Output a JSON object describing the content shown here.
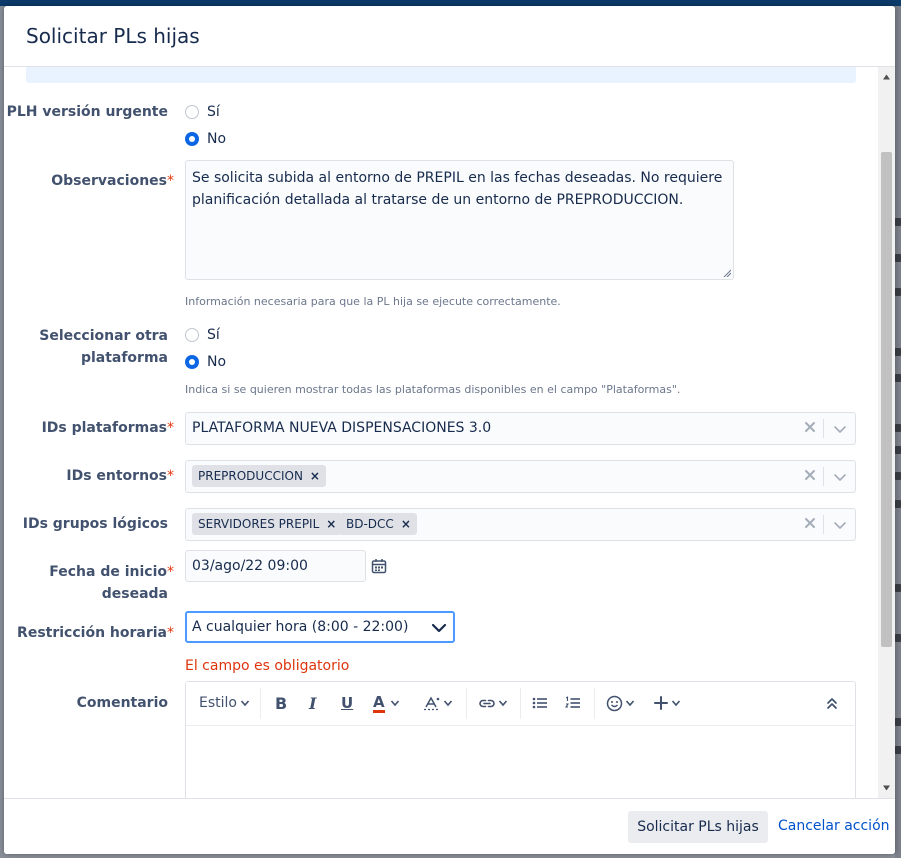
{
  "dialog": {
    "title": "Solicitar PLs hijas"
  },
  "fields": {
    "urgente": {
      "label": "PLH versión urgente",
      "options": [
        "Sí",
        "No"
      ],
      "selected": "No"
    },
    "observaciones": {
      "label": "Observaciones",
      "required_mark": "*",
      "value": "Se solicita subida al entorno de PREPIL en las fechas deseadas. No requiere planificación detallada al tratarse de un entorno de PREPRODUCCION.",
      "help": "Información necesaria para que la PL hija se ejecute correctamente."
    },
    "otra_plataforma": {
      "label_line1": "Seleccionar otra",
      "label_line2": "plataforma",
      "options": [
        "Sí",
        "No"
      ],
      "selected": "No",
      "help": "Indica si se quieren mostrar todas las plataformas disponibles en el campo \"Plataformas\"."
    },
    "plataformas": {
      "label": "IDs plataformas",
      "required_mark": "*",
      "value": "PLATAFORMA NUEVA DISPENSACIONES 3.0"
    },
    "entornos": {
      "label": "IDs entornos",
      "required_mark": "*",
      "chips": [
        "PREPRODUCCION"
      ]
    },
    "grupos": {
      "label": "IDs grupos lógicos",
      "chips": [
        "SERVIDORES PREPIL",
        "BD-DCC"
      ]
    },
    "fecha": {
      "label_line1": "Fecha de inicio",
      "label_line2": "deseada",
      "required_mark": "*",
      "value": "03/ago/22 09:00"
    },
    "restriccion": {
      "label": "Restricción horaria",
      "required_mark": "*",
      "value": "A cualquier hora (8:00 - 22:00)",
      "error": "El campo es obligatorio"
    },
    "comentario": {
      "label": "Comentario",
      "toolbar": {
        "style_label": "Estilo",
        "bold": "B",
        "italic": "I",
        "underline": "U",
        "text_color": "A"
      }
    }
  },
  "footer": {
    "submit_label": "Solicitar PLs hijas",
    "cancel_label": "Cancelar acción"
  },
  "colors": {
    "accent": "#0c66e4",
    "error": "#de350b",
    "link": "#0052cc",
    "focus_border": "#4c9aff"
  }
}
